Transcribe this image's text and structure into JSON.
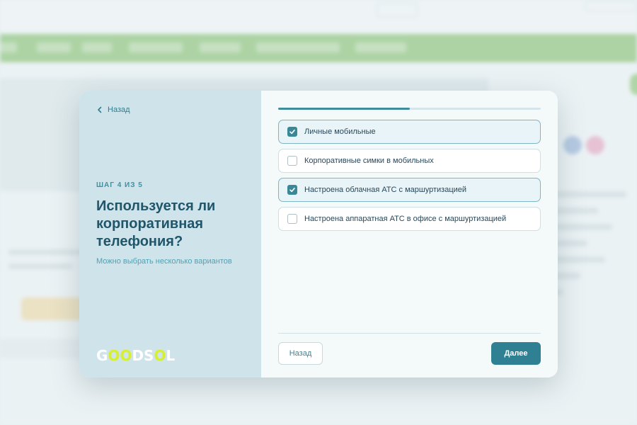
{
  "modal": {
    "back_link": "Назад",
    "step": "ШАГ 4 ИЗ 5",
    "question": "Используется ли корпоративная телефония?",
    "hint": "Можно выбрать несколько вариантов",
    "logo": {
      "g": "G",
      "o1": "O",
      "o2": "O",
      "rest_d": "DS",
      "o3": "O",
      "l": "L"
    },
    "progress_fraction": 0.5,
    "options": [
      {
        "label": "Личные мобильные",
        "checked": true
      },
      {
        "label": "Корпоративные симки в мобильных",
        "checked": false
      },
      {
        "label": "Настроена облачная АТС с маршуртизацией",
        "checked": true
      },
      {
        "label": "Настроена аппаратная АТС в офисе с маршуртизацией",
        "checked": false
      }
    ],
    "back_button": "Назад",
    "next_button": "Далее"
  },
  "colors": {
    "accent": "#2f8093",
    "left_panel": "#cfe3ea",
    "logo_highlight": "#d6ef2f"
  }
}
